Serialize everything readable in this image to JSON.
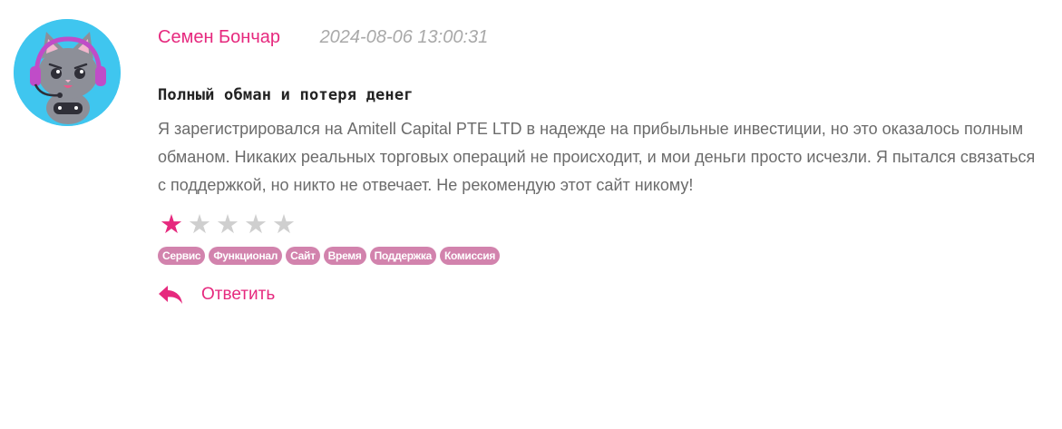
{
  "review": {
    "author": "Семен Бончар",
    "date": "2024-08-06 13:00:31",
    "title": "Полный обман и потеря денег",
    "text": "Я зарегистрировался на Amitell Capital PTE LTD в надежде на прибыльные инвестиции, но это оказалось полным обманом. Никаких реальных торговых операций не происходит, и мои деньги просто исчезли. Я пытался связаться с поддержкой, но никто не отвечает. Не рекомендую этот сайт никому!",
    "rating": 1,
    "rating_max": 5,
    "tags": [
      "Сервис",
      "Функционал",
      "Сайт",
      "Время",
      "Поддержка",
      "Комиссия"
    ],
    "reply_label": "Ответить"
  },
  "avatar": {
    "icon": "gamer-cat-avatar-icon"
  },
  "colors": {
    "accent": "#e6297e",
    "tag_bg": "#d283ad",
    "date": "#a9a9a9",
    "text": "#6b6b6b",
    "avatar_bg": "#3fc6ef",
    "star_off": "#cfcfcf"
  }
}
